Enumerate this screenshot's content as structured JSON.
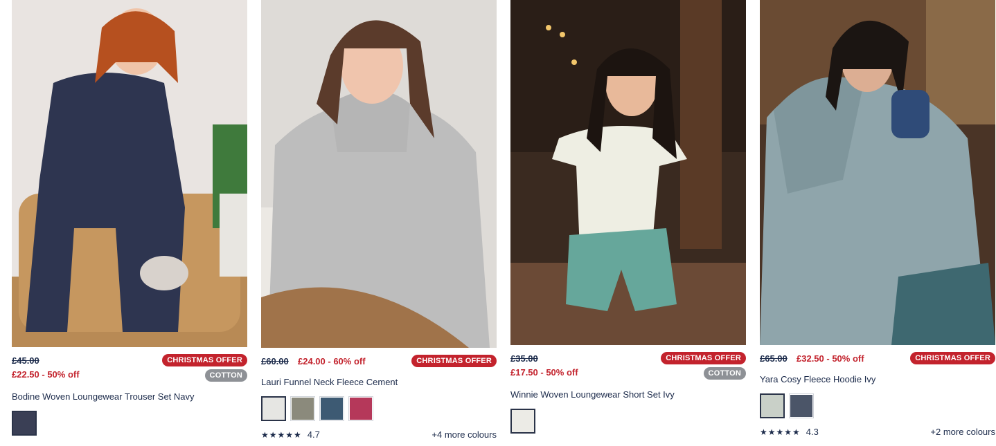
{
  "products": [
    {
      "was_price": "£45.00",
      "now_price": "£22.50 - 50% off",
      "badge_offer": "CHRISTMAS OFFER",
      "badge_fabric": "COTTON",
      "title": "Bodine Woven Loungewear Trouser Set Navy",
      "swatch_colors": [
        "#3a3f55"
      ]
    },
    {
      "was_price": "£60.00",
      "now_price": "£24.00 - 60% off",
      "badge_offer": "CHRISTMAS OFFER",
      "title": "Lauri Funnel Neck Fleece Cement",
      "swatch_colors": [
        "#e6e6e3",
        "#8b8a7c",
        "#3d5a73",
        "#b5385a"
      ],
      "stars": "★★★★★",
      "rating": "4.7",
      "more_colours": "+4 more colours"
    },
    {
      "was_price": "£35.00",
      "now_price": "£17.50 - 50% off",
      "badge_offer": "CHRISTMAS OFFER",
      "badge_fabric": "COTTON",
      "title": "Winnie Woven Loungewear Short Set Ivy",
      "swatch_colors": [
        "#ecebe6"
      ]
    },
    {
      "was_price": "£65.00",
      "now_price": "£32.50 - 50% off",
      "badge_offer": "CHRISTMAS OFFER",
      "title": "Yara Cosy Fleece Hoodie Ivy",
      "swatch_colors": [
        "#c9d0c8",
        "#4b5568"
      ],
      "stars": "★★★★★",
      "rating": "4.3",
      "more_colours": "+2 more colours"
    }
  ]
}
